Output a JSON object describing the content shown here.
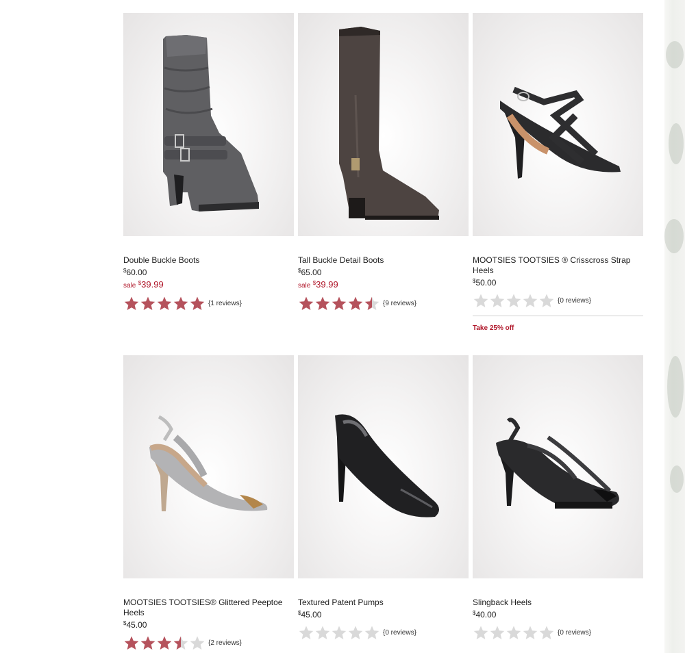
{
  "products": [
    {
      "name": "Double Buckle Boots",
      "price_symbol": "$",
      "price_value": "60.00",
      "sale_word": "sale",
      "sale_symbol": "$",
      "sale_value": "39.99",
      "rating": 5,
      "reviews": "{1 reviews}",
      "image": "grey-slouch-buckle-boot"
    },
    {
      "name": "Tall Buckle Detail Boots",
      "price_symbol": "$",
      "price_value": "65.00",
      "sale_word": "sale",
      "sale_symbol": "$",
      "sale_value": "39.99",
      "rating": 4.5,
      "reviews": "{9 reviews}",
      "image": "brown-tall-riding-boot"
    },
    {
      "name": "MOOTSIES TOOTSIES ® Crisscross Strap Heels",
      "price_symbol": "$",
      "price_value": "50.00",
      "rating": 0,
      "reviews": "{0 reviews}",
      "promo": "Take 25% off",
      "image": "black-crisscross-strap-sandal"
    },
    {
      "name": "MOOTSIES TOOTSIES® Glittered Peeptoe Heels",
      "price_symbol": "$",
      "price_value": "45.00",
      "rating": 3.5,
      "reviews": "{2 reviews}",
      "image": "silver-glitter-slingback-peeptoe"
    },
    {
      "name": "Textured Patent Pumps",
      "price_symbol": "$",
      "price_value": "45.00",
      "rating": 0,
      "reviews": "{0 reviews}",
      "image": "black-patent-pump"
    },
    {
      "name": "Slingback Heels",
      "price_symbol": "$",
      "price_value": "40.00",
      "rating": 0,
      "reviews": "{0 reviews}",
      "image": "black-slingback-peeptoe"
    }
  ],
  "colors": {
    "star_filled": "#b5525c",
    "star_empty": "#d9d9d9",
    "sale": "#b0172a"
  }
}
